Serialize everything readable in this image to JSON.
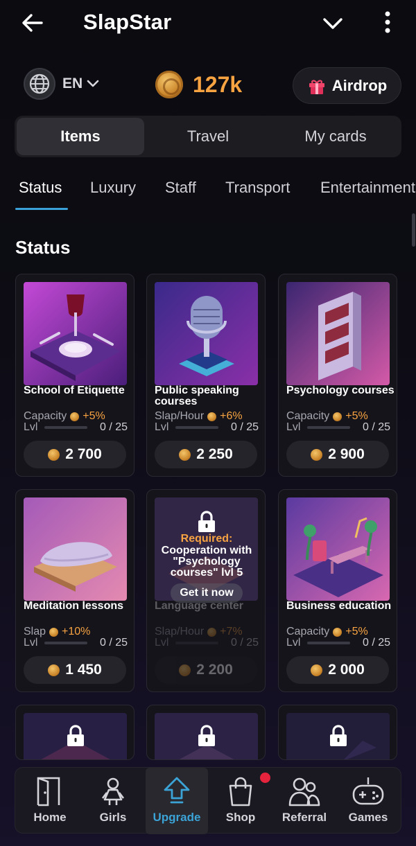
{
  "header": {
    "title": "SlapStar"
  },
  "topbar": {
    "language": "EN",
    "balance": "127k",
    "airdrop_label": "Airdrop"
  },
  "main_tabs": [
    "Items",
    "Travel",
    "My cards"
  ],
  "sub_tabs": [
    "Status",
    "Luxury",
    "Staff",
    "Transport",
    "Entertainment"
  ],
  "section_title": "Status",
  "cards": [
    {
      "name": "School of Etiquette",
      "stat_label": "Capacity",
      "stat_value": "+5%",
      "lvl_label": "Lvl",
      "progress": "0 / 25",
      "price": "2 700"
    },
    {
      "name": "Public speaking courses",
      "stat_label": "Slap/Hour",
      "stat_value": "+6%",
      "lvl_label": "Lvl",
      "progress": "0 / 25",
      "price": "2 250"
    },
    {
      "name": "Psychology courses",
      "stat_label": "Capacity",
      "stat_value": "+5%",
      "lvl_label": "Lvl",
      "progress": "0 / 25",
      "price": "2 900"
    },
    {
      "name": "Meditation lessons",
      "stat_label": "Slap",
      "stat_value": "+10%",
      "lvl_label": "Lvl",
      "progress": "0 / 25",
      "price": "1 450"
    },
    {
      "name": "Language center",
      "stat_label": "Slap/Hour",
      "stat_value": "+7%",
      "lvl_label": "Lvl",
      "progress": "0 / 25",
      "price": "2 200",
      "locked": {
        "required_label": "Required:",
        "required_text": "Cooperation with \"Psychology courses\" lvl 5",
        "cta": "Get it now"
      }
    },
    {
      "name": "Business education",
      "stat_label": "Capacity",
      "stat_value": "+5%",
      "lvl_label": "Lvl",
      "progress": "0 / 25",
      "price": "2 000"
    }
  ],
  "nav": [
    {
      "label": "Home",
      "icon": "door-icon"
    },
    {
      "label": "Girls",
      "icon": "girl-icon"
    },
    {
      "label": "Upgrade",
      "icon": "upgrade-arrow-icon",
      "active": true
    },
    {
      "label": "Shop",
      "icon": "shopping-bag-icon",
      "badge": true
    },
    {
      "label": "Referral",
      "icon": "people-icon"
    },
    {
      "label": "Games",
      "icon": "gamepad-icon"
    }
  ],
  "colors": {
    "accent_orange": "#f7a341",
    "accent_blue": "#3ba3d6",
    "badge_red": "#e5233c"
  }
}
